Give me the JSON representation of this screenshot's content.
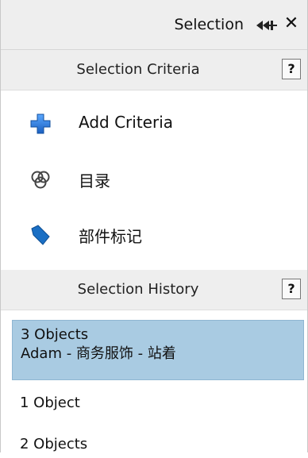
{
  "panel": {
    "title": "Selection",
    "pin_icon": "pin-icon",
    "close_label": "✕"
  },
  "criteria_section": {
    "header": "Selection Criteria",
    "help_label": "?",
    "items": [
      {
        "label": "Add Criteria",
        "icon": "add-plus-icon",
        "icon_color": "#1f6fd1"
      },
      {
        "label": "目录",
        "icon": "catalog-rings-icon",
        "icon_color": "#444444"
      },
      {
        "label": "部件标记",
        "icon": "tag-icon",
        "icon_color": "#1a6fc4"
      }
    ]
  },
  "history_section": {
    "header": "Selection History",
    "help_label": "?",
    "items": [
      {
        "line1": "3 Objects",
        "line2": "Adam - 商务服饰 - 站着",
        "selected": true
      },
      {
        "line1": "1 Object",
        "line2": "",
        "selected": false
      },
      {
        "line1": "2 Objects",
        "line2": "",
        "selected": false
      }
    ]
  },
  "colors": {
    "header_bg": "#eeeeee",
    "selected_bg": "#a9cbe2"
  }
}
